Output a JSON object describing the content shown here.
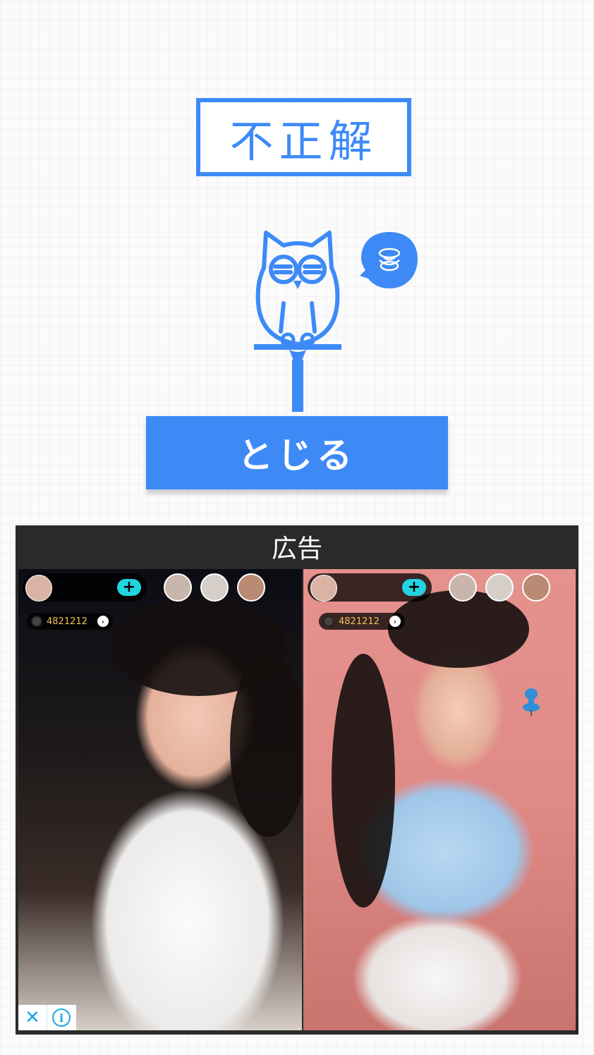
{
  "result": {
    "label": "不正解"
  },
  "close_button": {
    "label": "とじる"
  },
  "ad": {
    "header": "広告",
    "panels": [
      {
        "viewer_count": "4821212",
        "plus_label": "+"
      },
      {
        "viewer_count": "4821212",
        "plus_label": "+"
      }
    ],
    "controls": {
      "close_glyph": "✕",
      "info_glyph": "i"
    }
  },
  "colors": {
    "accent": "#3d8af7",
    "ad_bg": "#2a2a2a",
    "ad_control": "#1aa7e8"
  }
}
